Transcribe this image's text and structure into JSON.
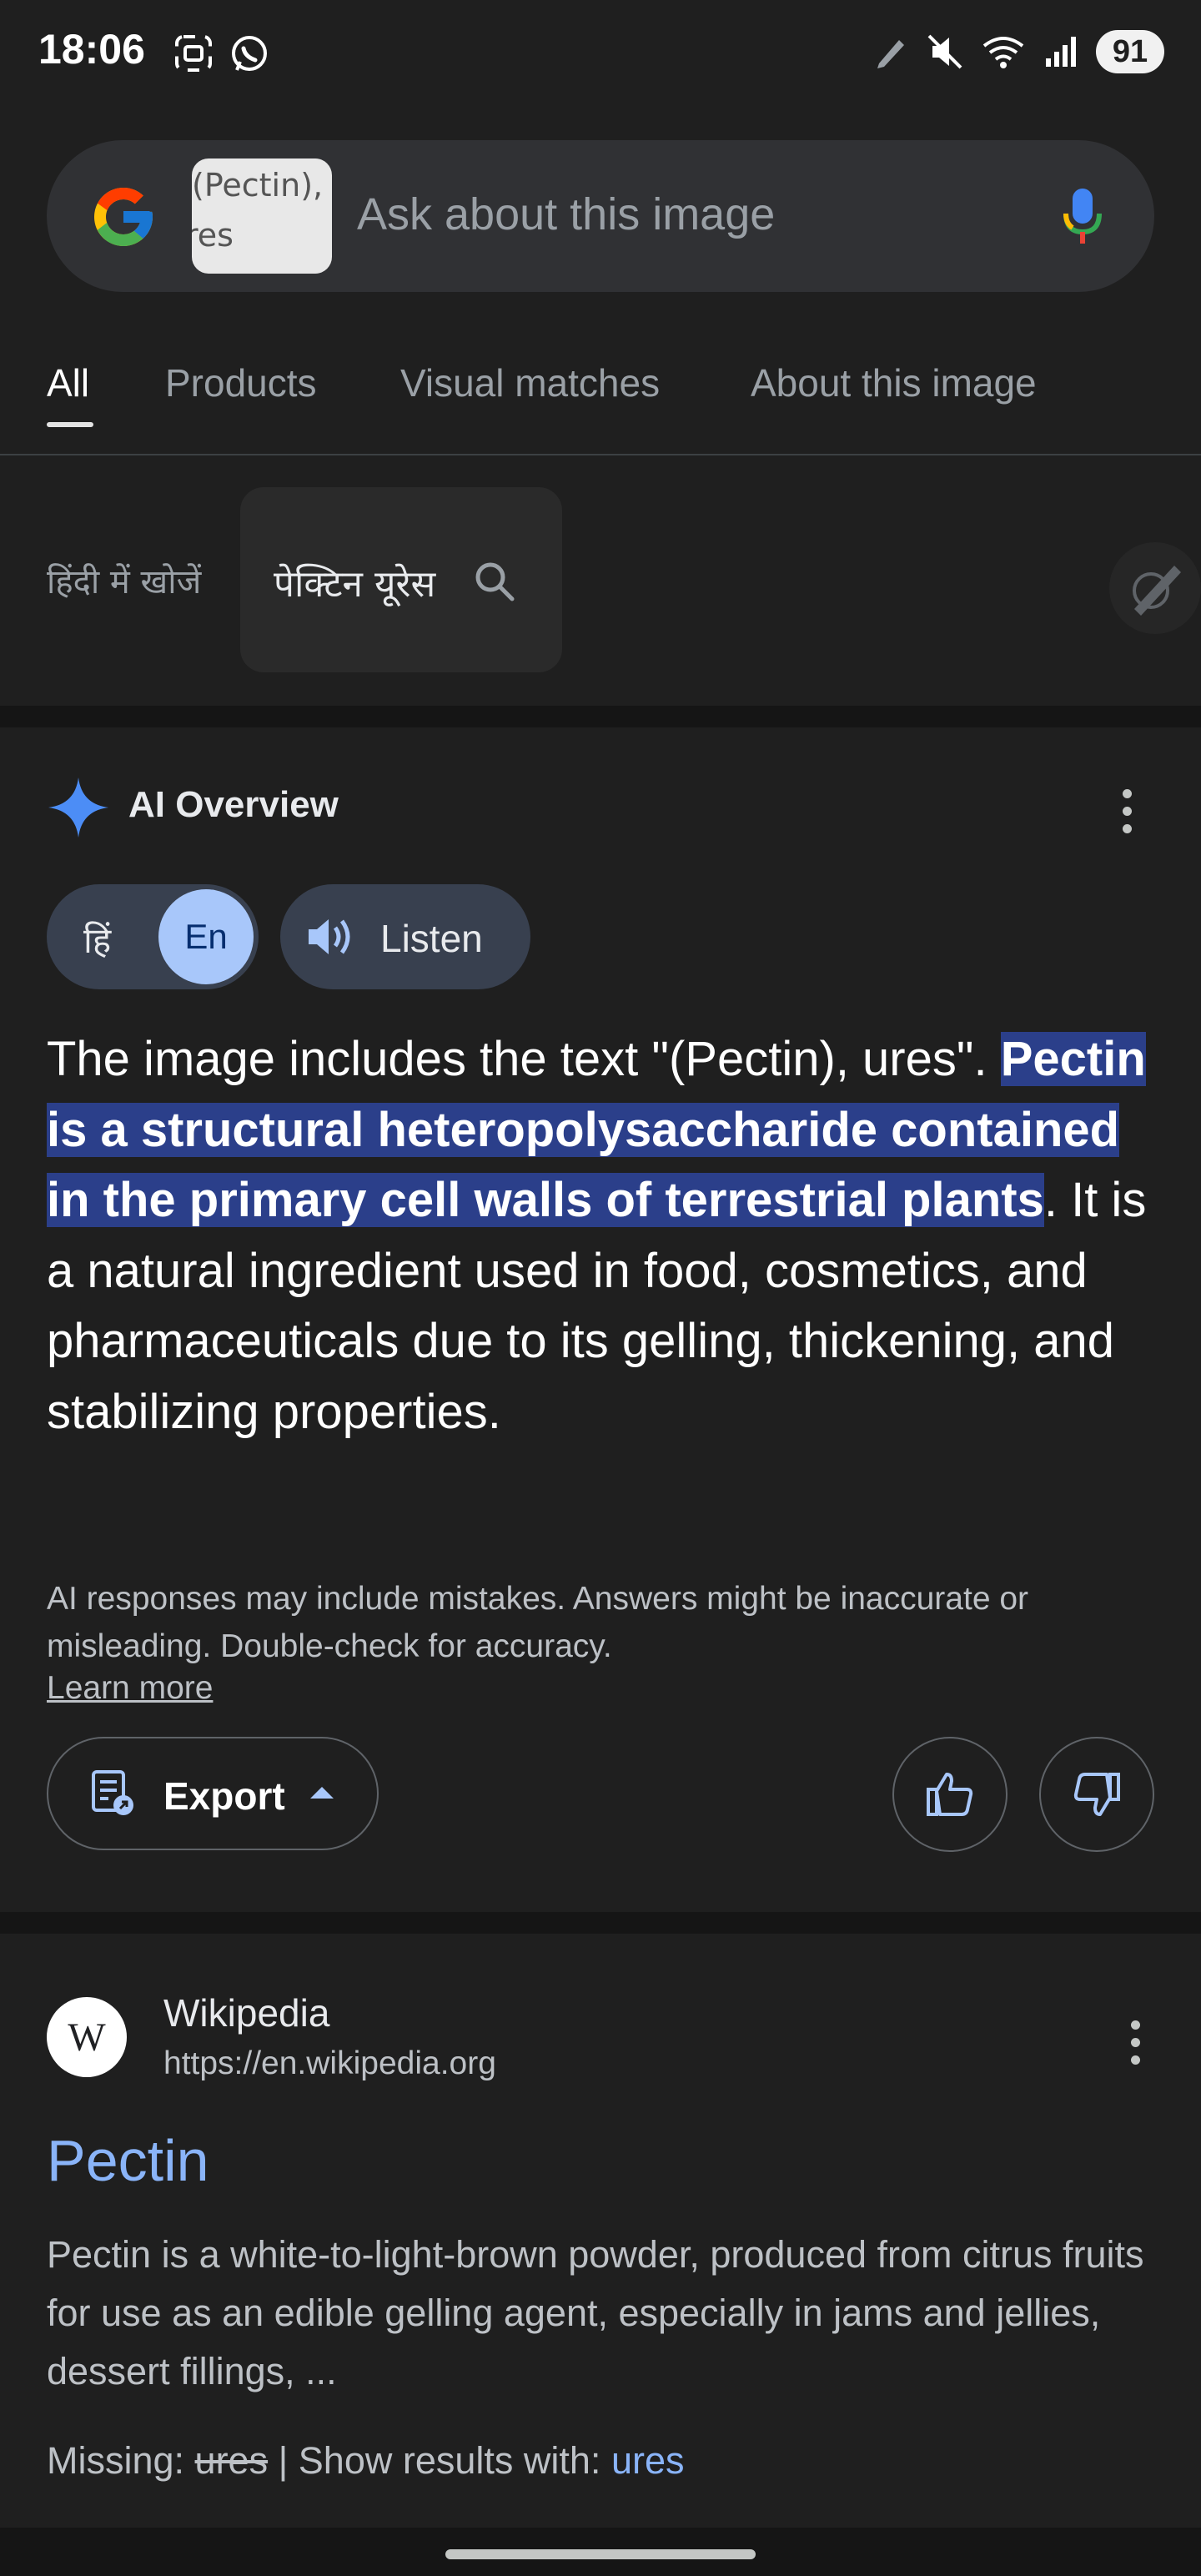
{
  "status_bar": {
    "time": "18:06",
    "battery": "91"
  },
  "search": {
    "thumbnail_text_line1": "(Pectin),",
    "thumbnail_text_line2": "res",
    "placeholder": "Ask about this image"
  },
  "tabs": [
    {
      "label": "All",
      "active": true
    },
    {
      "label": "Products",
      "active": false
    },
    {
      "label": "Visual matches",
      "active": false
    },
    {
      "label": "About this image",
      "active": false
    }
  ],
  "hindi_search": {
    "label": "हिंदी में खोजें",
    "query": "पेक्टिन यूरेस"
  },
  "ai_overview": {
    "title": "AI Overview",
    "lang_hi": "हिं",
    "lang_en": "En",
    "listen_label": "Listen",
    "text_intro": "The image includes the text \"(Pectin), ures\". ",
    "text_highlight": "Pectin is a structural heteropolysaccharide contained in the primary cell walls of terrestrial plants",
    "text_rest": ". It is a natural ingredient used in food, cosmetics, and pharmaceuticals due to its gelling, thickening, and stabilizing properties.",
    "disclaimer": "AI responses may include mistakes. Answers might be inaccurate or misleading. Double-check for accuracy.",
    "learn_more": "Learn more",
    "export_label": "Export"
  },
  "result": {
    "logo_letter": "W",
    "source_name": "Wikipedia",
    "source_url": "https://en.wikipedia.org",
    "title": "Pectin",
    "snippet": "Pectin is a white-to-light-brown powder, produced from citrus fruits for use as an edible gelling agent, especially in jams and jellies, dessert fillings, ...",
    "missing_label": "Missing: ",
    "missing_term": "ures",
    "show_with_label": " | Show results with: ",
    "show_with_term": "ures"
  },
  "colors": {
    "background": "#1f1f1f",
    "link_blue": "#8ab4f8",
    "highlight": "#2b3f8a",
    "accent_light_blue": "#a8c7fa"
  }
}
